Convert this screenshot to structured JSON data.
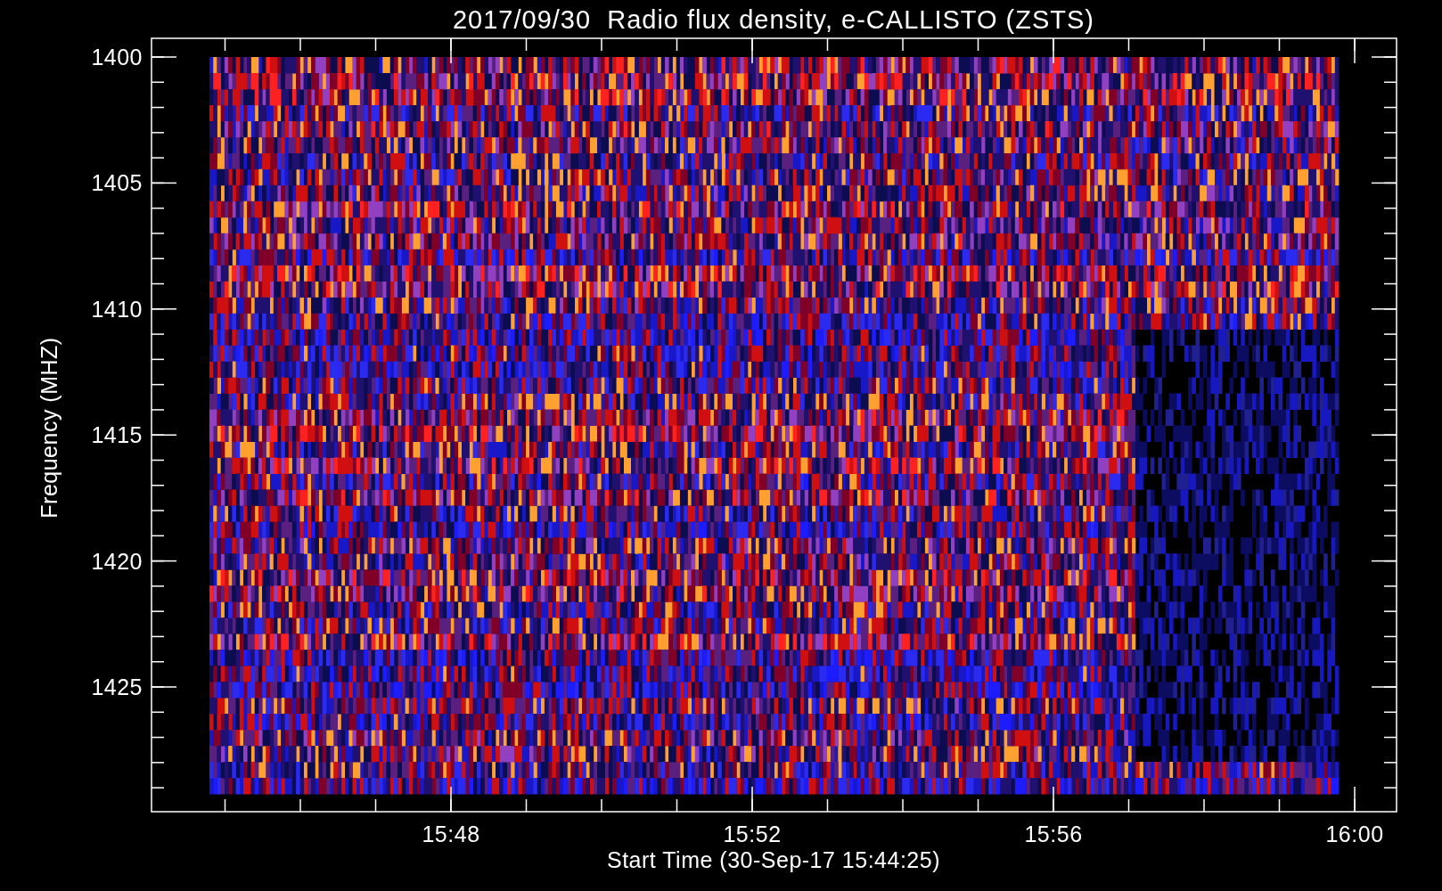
{
  "plot": {
    "title": "2017/09/30  Radio flux density, e-CALLISTO (ZSTS)",
    "xlabel": "Start Time (30-Sep-17 15:44:25)",
    "ylabel": "Frequency (MHZ)",
    "yticks": [
      "1400",
      "1405",
      "1410",
      "1415",
      "1420",
      "1425"
    ],
    "xticks": [
      "15:48",
      "15:52",
      "15:56",
      "16:00"
    ]
  }
}
